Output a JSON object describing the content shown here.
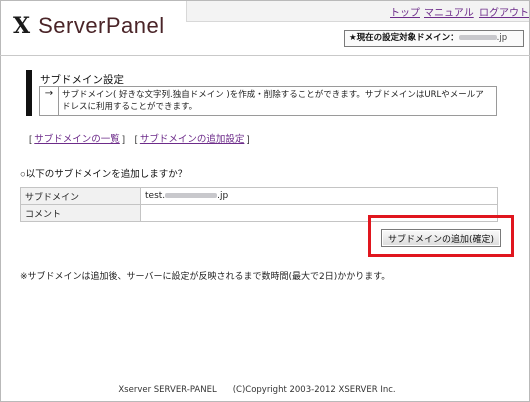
{
  "header": {
    "logo_mark": "X",
    "logo_text": "ServerPanel",
    "nav": [
      "トップ",
      "マニュアル",
      "ログアウト"
    ],
    "target_label": "★現在の設定対象ドメイン：",
    "target_domain_suffix": ".jp"
  },
  "section": {
    "title": "サブドメイン設定",
    "arrow": "→",
    "description": "サブドメイン( 好きな文字列.独自ドメイン )を作成・削除することができます。サブドメインはURLやメールアドレスに利用することができます。"
  },
  "links": {
    "list": "サブドメインの一覧",
    "add": "サブドメインの追加設定"
  },
  "form": {
    "question": "○以下のサブドメインを追加しますか？",
    "rows": [
      {
        "label": "サブドメイン",
        "value_prefix": "test.",
        "value_suffix": ".jp"
      },
      {
        "label": "コメント",
        "value": ""
      }
    ],
    "submit_label": "サブドメインの追加(確定)"
  },
  "note": "※サブドメインは追加後、サーバーに設定が反映されるまで数時間(最大で2日)かかります。",
  "footer": {
    "product": "Xserver SERVER-PANEL",
    "copyright": "(C)Copyright 2003-2012 XSERVER Inc."
  },
  "colors": {
    "link": "#6d2c8a",
    "logo_text": "#4a2428",
    "highlight": "#e0161e"
  }
}
